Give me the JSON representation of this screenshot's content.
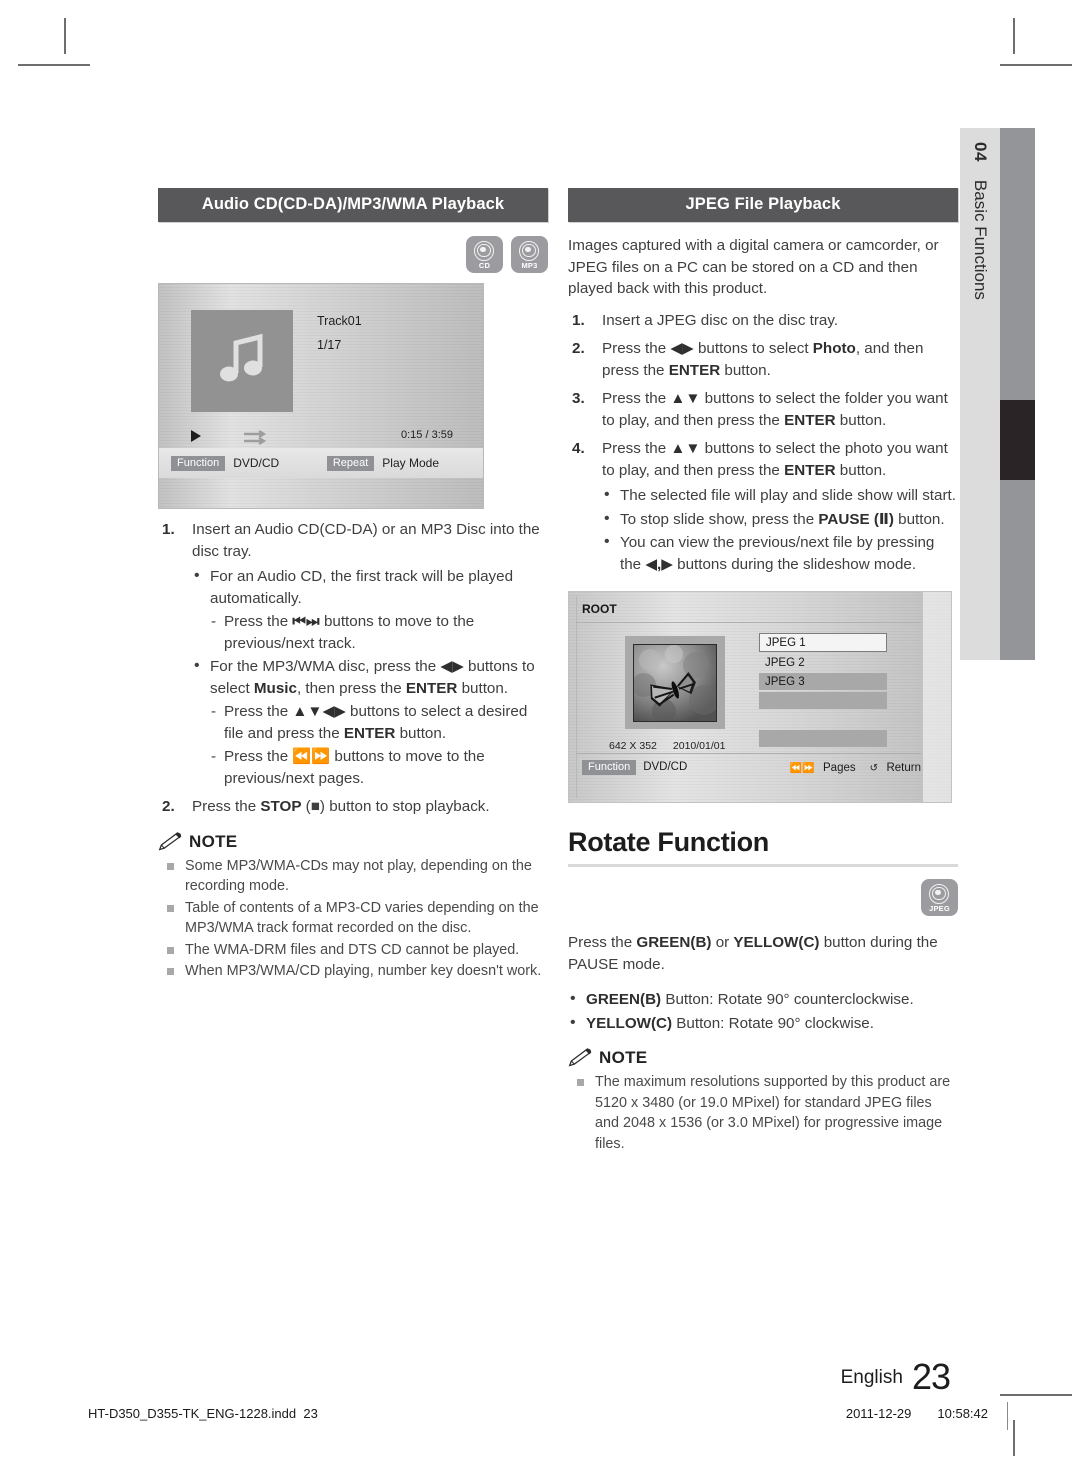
{
  "crop_marks": true,
  "side_tab": {
    "chapter_number": "04",
    "chapter_name": "Basic Functions"
  },
  "left_column": {
    "section_title": "Audio CD(CD-DA)/MP3/WMA Playback",
    "badges": [
      {
        "icon": "disc-icon",
        "label": "CD"
      },
      {
        "icon": "disc-icon",
        "label": "MP3"
      }
    ],
    "osd": {
      "track_name": "Track01",
      "track_index": "1/17",
      "time_elapsed": "0:15",
      "time_separator": "/",
      "time_total": "3:59",
      "function_chip": "Function",
      "function_value": "DVD/CD",
      "repeat_chip": "Repeat",
      "play_mode": "Play Mode",
      "art_icon": "music-note-icon",
      "play_icon": "play-icon",
      "shuffle_icon": "shuffle-icon"
    },
    "steps": [
      {
        "num": "1.",
        "text": "Insert an Audio CD(CD-DA) or an MP3 Disc into the disc tray.",
        "bullets": [
          {
            "text_a": "For an Audio CD, the first track will be played automatically.",
            "dashes": [
              {
                "pre": "Press the ",
                "sym": "⏮⏭",
                "post": " buttons to move to the previous/next track."
              }
            ]
          },
          {
            "text_a": "For the MP3/WMA disc, press the ",
            "sym_a": "◀▶",
            "text_b": " buttons to select ",
            "bold_b": "Music",
            "text_c": ", then press the ",
            "bold_c": "ENTER",
            "text_d": " button.",
            "dashes": [
              {
                "pre": "Press the ",
                "sym": "▲▼◀▶",
                "post": " buttons to select  a desired file and press the ",
                "bold": "ENTER",
                "tail": " button."
              },
              {
                "pre": "Press the ",
                "sym": "⏪⏩",
                "post": " buttons to move to the previous/next pages."
              }
            ]
          }
        ]
      },
      {
        "num": "2.",
        "pre": "Press the ",
        "bold": "STOP",
        "sym": " (■) ",
        "post": "button to stop playback."
      }
    ],
    "note": {
      "icon": "pencil-icon",
      "title": "NOTE",
      "items": [
        "Some MP3/WMA-CDs may not play, depending on the recording mode.",
        "Table of contents of a MP3-CD varies depending on the MP3/WMA track format recorded on the disc.",
        "The WMA-DRM files and DTS CD cannot be played.",
        "When MP3/WMA/CD playing, number key doesn't work."
      ]
    }
  },
  "right_column": {
    "section_title": "JPEG File Playback",
    "intro": "Images captured with a digital camera or camcorder, or JPEG files on a PC can be stored on a CD and then played back with this product.",
    "steps": [
      {
        "num": "1.",
        "text": "Insert a JPEG disc on the disc tray."
      },
      {
        "num": "2.",
        "pre": "Press the ",
        "sym": "◀▶",
        "mid": " buttons to select ",
        "bold1": "Photo",
        "mid2": ", and then press the ",
        "bold2": "ENTER",
        "post": " button."
      },
      {
        "num": "3.",
        "pre": "Press the ",
        "sym": "▲▼",
        "mid": " buttons to select the folder you want to play, and then press the ",
        "bold2": "ENTER",
        "post": " button."
      },
      {
        "num": "4.",
        "pre": "Press the ",
        "sym": "▲▼",
        "mid": " buttons to select the photo you want to play, and then press the ",
        "bold2": "ENTER",
        "post": " button."
      }
    ],
    "step4_bullets": [
      {
        "text": "The selected file will play and slide show will start."
      },
      {
        "pre": "To stop slide show, press the ",
        "bold": "PAUSE",
        "sym": " (Ⅱ) ",
        "post": "button."
      },
      {
        "pre": "You can view the previous/next file by pressing the ",
        "sym": "◀,▶",
        "post": " buttons during the slideshow mode."
      }
    ],
    "osd": {
      "root_label": "ROOT",
      "files": [
        "JPEG 1",
        "JPEG 2",
        "JPEG 3"
      ],
      "resolution": "642 X 352",
      "date": "2010/01/01",
      "function_chip": "Function",
      "function_value": "DVD/CD",
      "pages_sym": "⏪⏩",
      "pages_label": "Pages",
      "return_sym": "↺",
      "return_label": "Return",
      "thumb_icon": "butterfly-photo"
    },
    "rotate": {
      "heading": "Rotate Function",
      "badge": {
        "icon": "disc-icon",
        "label": "JPEG"
      },
      "intro_pre": "Press the ",
      "intro_b1": "GREEN(B)",
      "intro_mid": " or ",
      "intro_b2": "YELLOW(C)",
      "intro_post": " button during the PAUSE mode.",
      "bullets": [
        {
          "bold": "GREEN(B)",
          "text": " Button: Rotate 90° counterclockwise."
        },
        {
          "bold": "YELLOW(C)",
          "text": " Button: Rotate 90° clockwise."
        }
      ],
      "note": {
        "icon": "pencil-icon",
        "title": "NOTE",
        "items": [
          "The maximum resolutions supported by this product are 5120 x 3480 (or 19.0 MPixel) for standard JPEG files and 2048 x 1536 (or 3.0 MPixel) for progressive image files."
        ]
      }
    }
  },
  "footer": {
    "language": "English",
    "page_number": "23",
    "file_name": "HT-D350_D355-TK_ENG-1228.indd",
    "file_page": "23",
    "print_date": "2011-12-29",
    "print_time": "10:58:42"
  },
  "colors": {
    "header_bar": "#58585a",
    "badge_gray": "#9c9ca0",
    "side_tab_strip": "#dcdcdc",
    "side_tab_bar": "#949598",
    "side_tab_active": "#2a2426"
  }
}
